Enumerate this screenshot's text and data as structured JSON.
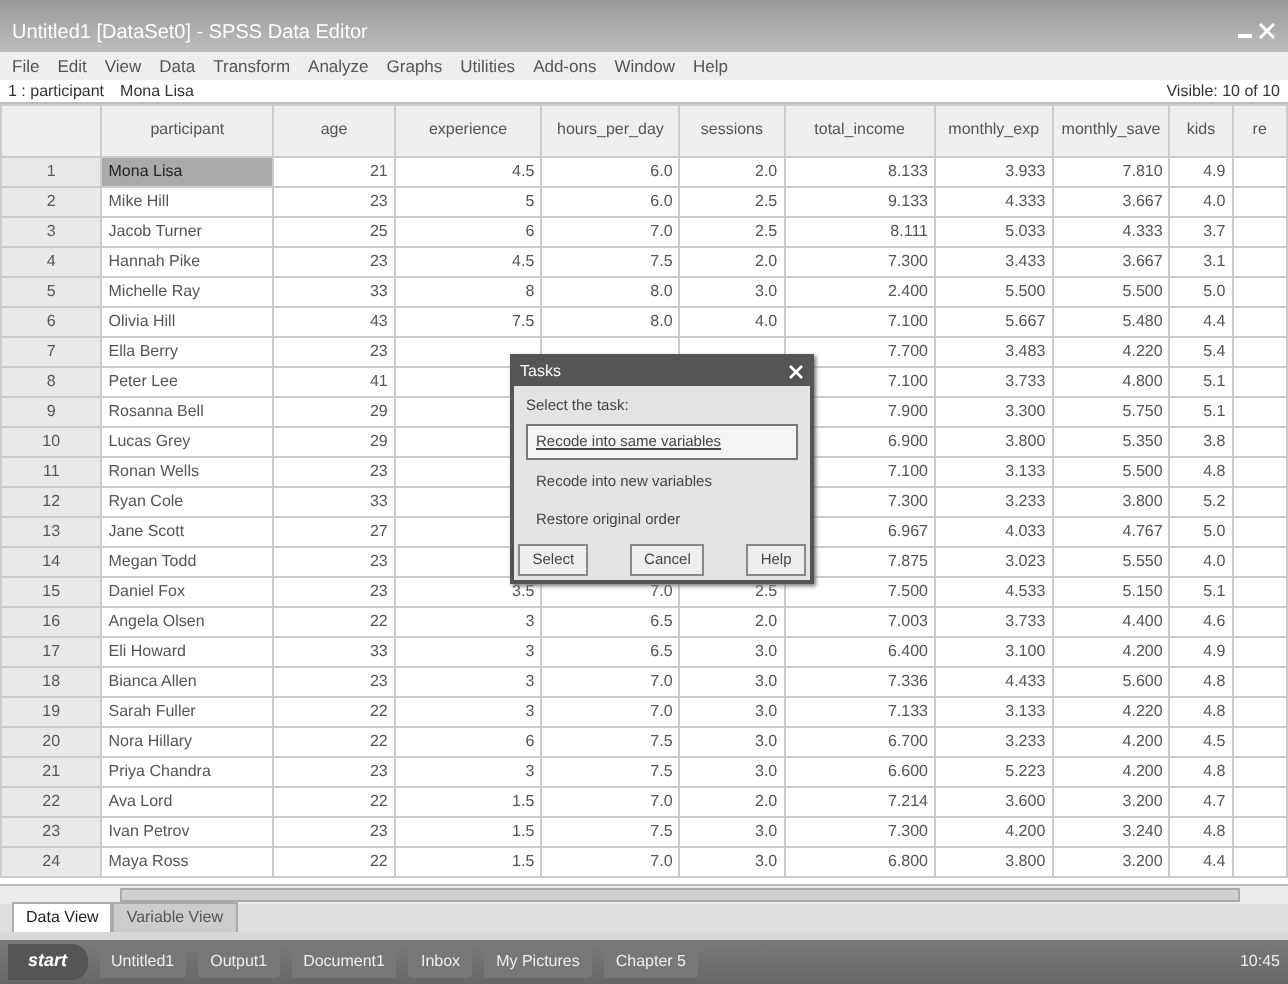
{
  "window": {
    "title": "Untitled1 [DataSet0] - SPSS Data Editor"
  },
  "menu": [
    "File",
    "Edit",
    "View",
    "Data",
    "Transform",
    "Analyze",
    "Graphs",
    "Utilities",
    "Add-ons",
    "Window",
    "Help"
  ],
  "cell_editor": {
    "cell": "1 : participant",
    "value": "Mona Lisa"
  },
  "visible_info": "Visible: 10 of 10",
  "table": {
    "columns": [
      "participant",
      "age",
      "experience",
      "hours_per_day",
      "sessions",
      "total_income",
      "monthly_exp",
      "monthly_save",
      "kids",
      "re"
    ],
    "rows": [
      {
        "number": "1",
        "selected": true,
        "cells": [
          "Mona Lisa",
          "21",
          "4.5",
          "6.0",
          "2.0",
          "8.133",
          "3.933",
          "7.810",
          "4.9"
        ]
      },
      {
        "number": "2",
        "selected": false,
        "cells": [
          "Mike Hill",
          "23",
          "5",
          "6.0",
          "2.5",
          "9.133",
          "4.333",
          "3.667",
          "4.0"
        ]
      },
      {
        "number": "3",
        "selected": false,
        "cells": [
          "Jacob Turner",
          "25",
          "6",
          "7.0",
          "2.5",
          "8.111",
          "5.033",
          "4.333",
          "3.7"
        ]
      },
      {
        "number": "4",
        "selected": false,
        "cells": [
          "Hannah Pike",
          "23",
          "4.5",
          "7.5",
          "2.0",
          "7.300",
          "3.433",
          "3.667",
          "3.1"
        ]
      },
      {
        "number": "5",
        "selected": false,
        "cells": [
          "Michelle Ray",
          "33",
          "8",
          "8.0",
          "3.0",
          "2.400",
          "5.500",
          "5.500",
          "5.0"
        ]
      },
      {
        "number": "6",
        "selected": false,
        "cells": [
          "Olivia Hill",
          "43",
          "7.5",
          "8.0",
          "4.0",
          "7.100",
          "5.667",
          "5.480",
          "4.4"
        ]
      },
      {
        "number": "7",
        "selected": false,
        "cells": [
          "Ella Berry",
          "23",
          null,
          null,
          null,
          "7.700",
          "3.483",
          "4.220",
          "5.4"
        ]
      },
      {
        "number": "8",
        "selected": false,
        "cells": [
          "Peter Lee",
          "41",
          null,
          null,
          null,
          "7.100",
          "3.733",
          "4.800",
          "5.1"
        ]
      },
      {
        "number": "9",
        "selected": false,
        "cells": [
          "Rosanna Bell",
          "29",
          null,
          null,
          null,
          "7.900",
          "3.300",
          "5.750",
          "5.1"
        ]
      },
      {
        "number": "10",
        "selected": false,
        "cells": [
          "Lucas Grey",
          "29",
          null,
          null,
          null,
          "6.900",
          "3.800",
          "5.350",
          "3.8"
        ]
      },
      {
        "number": "11",
        "selected": false,
        "cells": [
          "Ronan Wells",
          "23",
          null,
          null,
          null,
          "7.100",
          "3.133",
          "5.500",
          "4.8"
        ]
      },
      {
        "number": "12",
        "selected": false,
        "cells": [
          "Ryan Cole",
          "33",
          null,
          null,
          null,
          "7.300",
          "3.233",
          "3.800",
          "5.2"
        ]
      },
      {
        "number": "13",
        "selected": false,
        "cells": [
          "Jane Scott",
          "27",
          null,
          null,
          null,
          "6.967",
          "4.033",
          "4.767",
          "5.0"
        ]
      },
      {
        "number": "14",
        "selected": false,
        "cells": [
          "Megan Todd",
          "23",
          null,
          null,
          null,
          "7.875",
          "3.023",
          "5.550",
          "4.0"
        ]
      },
      {
        "number": "15",
        "selected": false,
        "cells": [
          "Daniel Fox",
          "23",
          "3.5",
          "7.0",
          "2.5",
          "7.500",
          "4.533",
          "5.150",
          "5.1"
        ]
      },
      {
        "number": "16",
        "selected": false,
        "cells": [
          "Angela Olsen",
          "22",
          "3",
          "6.5",
          "2.0",
          "7.003",
          "3.733",
          "4.400",
          "4.6"
        ]
      },
      {
        "number": "17",
        "selected": false,
        "cells": [
          "Eli Howard",
          "33",
          "3",
          "6.5",
          "3.0",
          "6.400",
          "3.100",
          "4.200",
          "4.9"
        ]
      },
      {
        "number": "18",
        "selected": false,
        "cells": [
          "Bianca Allen",
          "23",
          "3",
          "7.0",
          "3.0",
          "7.336",
          "4.433",
          "5.600",
          "4.8"
        ]
      },
      {
        "number": "19",
        "selected": false,
        "cells": [
          "Sarah Fuller",
          "22",
          "3",
          "7.0",
          "3.0",
          "7.133",
          "3.133",
          "4.220",
          "4.8"
        ]
      },
      {
        "number": "20",
        "selected": false,
        "cells": [
          "Nora Hillary",
          "22",
          "6",
          "7.5",
          "3.0",
          "6.700",
          "3.233",
          "4.200",
          "4.5"
        ]
      },
      {
        "number": "21",
        "selected": false,
        "cells": [
          "Priya Chandra",
          "23",
          "3",
          "7.5",
          "3.0",
          "6.600",
          "5.223",
          "4.200",
          "4.8"
        ]
      },
      {
        "number": "22",
        "selected": false,
        "cells": [
          "Ava Lord",
          "22",
          "1.5",
          "7.0",
          "2.0",
          "7.214",
          "3.600",
          "3.200",
          "4.7"
        ]
      },
      {
        "number": "23",
        "selected": false,
        "cells": [
          "Ivan Petrov",
          "23",
          "1.5",
          "7.5",
          "3.0",
          "7.300",
          "4.200",
          "3.240",
          "4.8"
        ]
      },
      {
        "number": "24",
        "selected": false,
        "cells": [
          "Maya Ross",
          "22",
          "1.5",
          "7.0",
          "3.0",
          "6.800",
          "3.800",
          "3.200",
          "4.4"
        ]
      }
    ]
  },
  "dialog": {
    "title": "Tasks",
    "prompt": "Select the task:",
    "options": [
      {
        "label": "Recode into same variables",
        "selected": true
      },
      {
        "label": "Recode into new variables",
        "selected": false
      },
      {
        "label": "Restore original order",
        "selected": false
      }
    ],
    "buttons": [
      "Select",
      "Cancel",
      "Help"
    ]
  },
  "sheet_tabs": [
    {
      "label": "Data View",
      "selected": true
    },
    {
      "label": "Variable View",
      "selected": false
    }
  ],
  "taskbar": {
    "start": "start",
    "items": [
      "Untitled1",
      "Output1",
      "Document1",
      "Inbox",
      "My Pictures",
      "Chapter 5"
    ],
    "clock": "10:45"
  }
}
